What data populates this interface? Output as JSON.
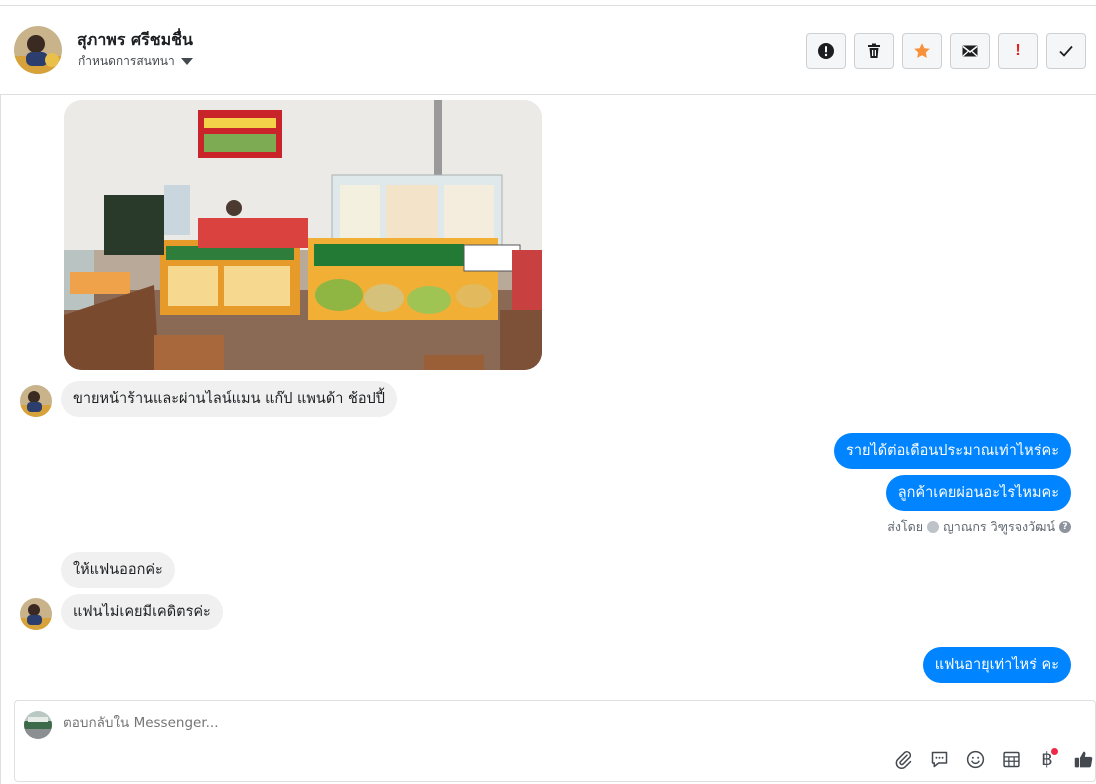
{
  "header": {
    "contact_name": "สุภาพร ศรีชมชื่น",
    "subtitle": "กำหนดการสนทนา",
    "toolbar": [
      {
        "name": "alert-button",
        "icon": "alert-circle-icon"
      },
      {
        "name": "delete-button",
        "icon": "trash-icon"
      },
      {
        "name": "star-button",
        "icon": "star-icon"
      },
      {
        "name": "mark-unread-button",
        "icon": "envelope-icon"
      },
      {
        "name": "spam-button",
        "icon": "exclamation-icon"
      },
      {
        "name": "done-button",
        "icon": "check-icon"
      }
    ]
  },
  "messages": [
    {
      "type": "image",
      "from": "in",
      "alt": "shop photo"
    },
    {
      "type": "text",
      "from": "in",
      "text": "ขายหน้าร้านและผ่านไลน์แมน แก๊ป แพนด้า ช้อปปี้"
    },
    {
      "type": "text",
      "from": "out",
      "text": "รายได้ต่อเดือนประมาณเท่าไหร่คะ"
    },
    {
      "type": "text",
      "from": "out",
      "text": "ลูกค้าเคยผ่อนอะไรไหมคะ"
    },
    {
      "type": "text",
      "from": "in",
      "text": "ให้แฟนออกค่ะ"
    },
    {
      "type": "text",
      "from": "in",
      "text": "แฟนไม่เคยมีเคดิตรค่ะ"
    },
    {
      "type": "text",
      "from": "out",
      "text": "แฟนอายุเท่าไหร่ คะ"
    }
  ],
  "sent_by": {
    "prefix": "ส่งโดย",
    "name": "ญาณกร วิฑูรจงวัฒน์"
  },
  "composer": {
    "placeholder": "ตอบกลับใน Messenger...",
    "tools": [
      "paperclip-icon",
      "speech-bubble-icon",
      "emoji-icon",
      "table-icon",
      "baht-icon",
      "thumbs-up-icon"
    ],
    "baht_symbol": "฿"
  },
  "colors": {
    "outgoing_bubble": "#0084ff",
    "incoming_bubble": "#f0f0f0",
    "star": "#f7923b",
    "alert_red": "#e02424"
  }
}
